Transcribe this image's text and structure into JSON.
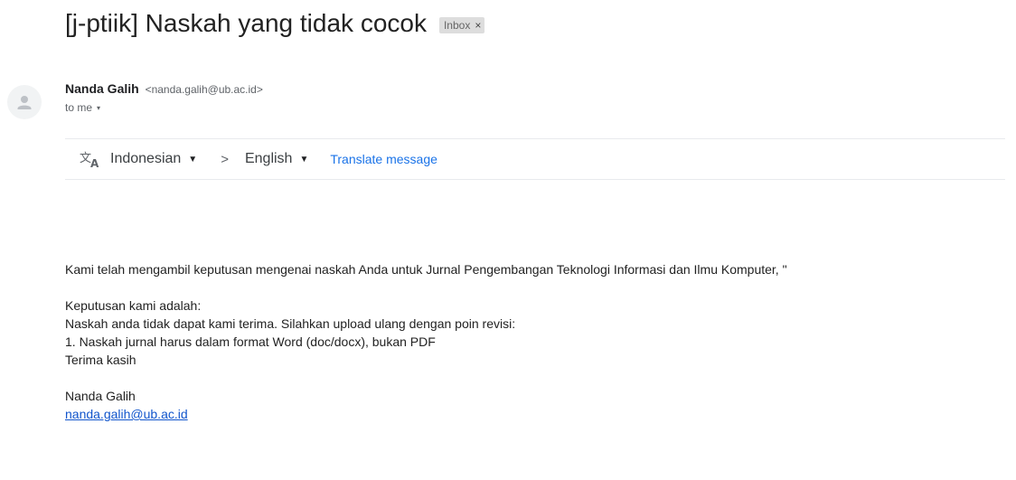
{
  "email": {
    "subject": "[j-ptiik] Naskah yang tidak cocok",
    "label": "Inbox",
    "label_close": "×",
    "sender_name": "Nanda Galih",
    "sender_email": "<nanda.galih@ub.ac.id>",
    "to_text": "to me",
    "to_caret": "▾"
  },
  "translate": {
    "icon": "translate-icon",
    "from_lang": "Indonesian",
    "to_lang": "English",
    "caret": "▼",
    "arrow": ">",
    "action": "Translate message"
  },
  "body": {
    "intro": "Kami telah mengambil keputusan mengenai naskah Anda untuk Jurnal Pengembangan Teknologi Informasi dan Ilmu Komputer, \"",
    "decision_heading": "Keputusan kami adalah:",
    "decision_line": "Naskah anda tidak dapat kami terima. Silahkan upload ulang dengan poin revisi:",
    "revision_point": "1. Naskah jurnal harus dalam format Word (doc/docx), bukan PDF",
    "closing": "Terima kasih",
    "signature_name": "Nanda Galih",
    "signature_email": "nanda.galih@ub.ac.id"
  },
  "colors": {
    "link": "#1155cc",
    "translate_link": "#1a73e8",
    "label_bg": "#dddddd"
  }
}
